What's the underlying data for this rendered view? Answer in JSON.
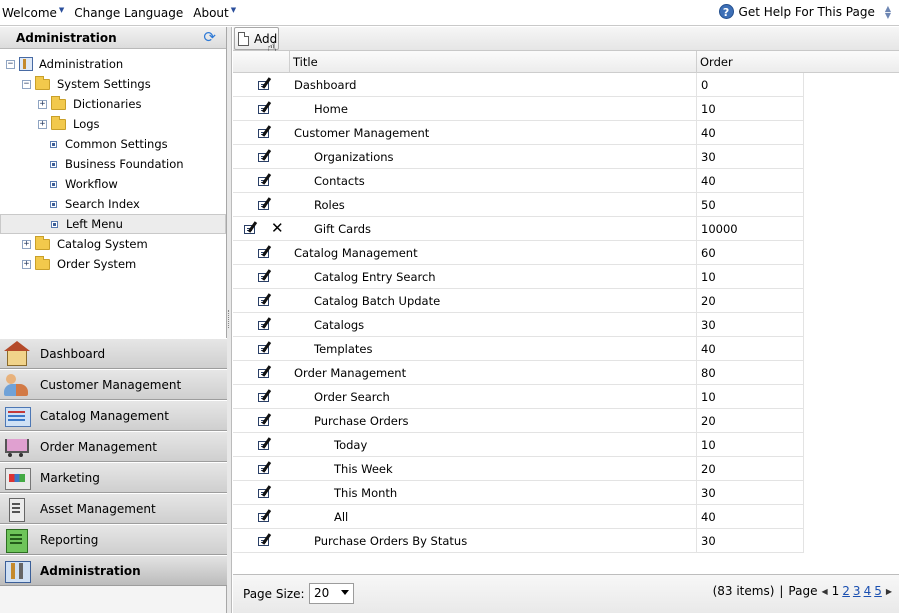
{
  "topbar": {
    "menu": [
      {
        "label": "Welcome",
        "dropdown": true
      },
      {
        "label": "Change Language",
        "dropdown": false
      },
      {
        "label": "About",
        "dropdown": true
      }
    ],
    "help_label": "Get Help For This Page",
    "help_icon": "question-icon"
  },
  "sidebar": {
    "header": "Administration",
    "tree": [
      {
        "label": "Administration",
        "level": 0,
        "type": "root",
        "expanded": true
      },
      {
        "label": "System Settings",
        "level": 1,
        "type": "folder",
        "expanded": true
      },
      {
        "label": "Dictionaries",
        "level": 2,
        "type": "folder",
        "expanded": false
      },
      {
        "label": "Logs",
        "level": 2,
        "type": "folder",
        "expanded": false
      },
      {
        "label": "Common Settings",
        "level": 2,
        "type": "leaf"
      },
      {
        "label": "Business Foundation",
        "level": 2,
        "type": "leaf"
      },
      {
        "label": "Workflow",
        "level": 2,
        "type": "leaf"
      },
      {
        "label": "Search Index",
        "level": 2,
        "type": "leaf"
      },
      {
        "label": "Left Menu",
        "level": 2,
        "type": "leaf",
        "selected": true
      },
      {
        "label": "Catalog System",
        "level": 1,
        "type": "folder",
        "expanded": false
      },
      {
        "label": "Order System",
        "level": 1,
        "type": "folder",
        "expanded": false
      }
    ],
    "nav": [
      {
        "label": "Dashboard",
        "icon": "home-icon"
      },
      {
        "label": "Customer Management",
        "icon": "people-icon"
      },
      {
        "label": "Catalog Management",
        "icon": "catalog-icon"
      },
      {
        "label": "Order Management",
        "icon": "cart-icon"
      },
      {
        "label": "Marketing",
        "icon": "marketing-icon"
      },
      {
        "label": "Asset Management",
        "icon": "asset-icon"
      },
      {
        "label": "Reporting",
        "icon": "reporting-icon"
      },
      {
        "label": "Administration",
        "icon": "admin-icon",
        "active": true
      }
    ]
  },
  "toolbar": {
    "add_label": "Add"
  },
  "grid": {
    "columns": [
      "Title",
      "Order"
    ],
    "rows": [
      {
        "title": "Dashboard",
        "order": "0",
        "indent": 0
      },
      {
        "title": "Home",
        "order": "10",
        "indent": 1
      },
      {
        "title": "Customer Management",
        "order": "40",
        "indent": 0
      },
      {
        "title": "Organizations",
        "order": "30",
        "indent": 1
      },
      {
        "title": "Contacts",
        "order": "40",
        "indent": 1
      },
      {
        "title": "Roles",
        "order": "50",
        "indent": 1
      },
      {
        "title": "Gift Cards",
        "order": "10000",
        "indent": 1,
        "deletable": true
      },
      {
        "title": "Catalog Management",
        "order": "60",
        "indent": 0
      },
      {
        "title": "Catalog Entry Search",
        "order": "10",
        "indent": 1
      },
      {
        "title": "Catalog Batch Update",
        "order": "20",
        "indent": 1
      },
      {
        "title": "Catalogs",
        "order": "30",
        "indent": 1
      },
      {
        "title": "Templates",
        "order": "40",
        "indent": 1
      },
      {
        "title": "Order Management",
        "order": "80",
        "indent": 0
      },
      {
        "title": "Order Search",
        "order": "10",
        "indent": 1
      },
      {
        "title": "Purchase Orders",
        "order": "20",
        "indent": 1
      },
      {
        "title": "Today",
        "order": "10",
        "indent": 2
      },
      {
        "title": "This Week",
        "order": "20",
        "indent": 2
      },
      {
        "title": "This Month",
        "order": "30",
        "indent": 2
      },
      {
        "title": "All",
        "order": "40",
        "indent": 2
      },
      {
        "title": "Purchase Orders By Status",
        "order": "30",
        "indent": 1
      }
    ]
  },
  "pager": {
    "page_size_label": "Page Size:",
    "page_size_value": "20",
    "items_text": "(83 items)",
    "page_label": "Page",
    "current_page": "1",
    "pages": [
      "2",
      "3",
      "4",
      "5"
    ]
  }
}
